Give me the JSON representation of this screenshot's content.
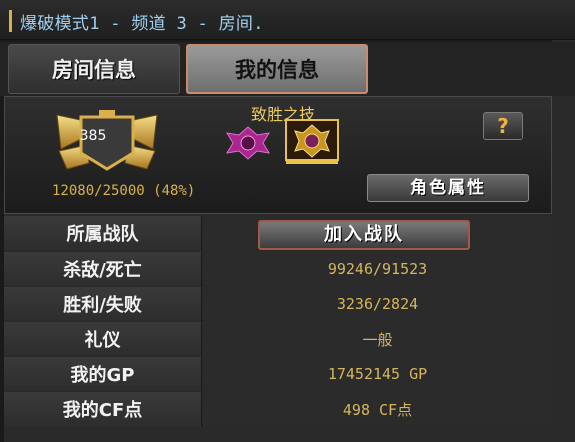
{
  "title_bar": {
    "text": "爆破模式1 - 频道 3 - 房间."
  },
  "tabs": [
    {
      "label": "房间信息",
      "active": false
    },
    {
      "label": "我的信息",
      "active": true
    }
  ],
  "profile": {
    "rank": "385",
    "exp": "12080/25000 (48%)",
    "skills_title": "致胜之技",
    "skills": [
      "pink-emblem-icon",
      "gold-emblem-icon"
    ],
    "help_label": "?",
    "attributes_button": "角色属性"
  },
  "stats": [
    {
      "label": "所属战队",
      "value": "",
      "button": "加入战队"
    },
    {
      "label": "杀敌/死亡",
      "value": "99246/91523"
    },
    {
      "label": "胜利/失败",
      "value": "3236/2824"
    },
    {
      "label": "礼仪",
      "value": "一般"
    },
    {
      "label": "我的GP",
      "value": "17452145 GP"
    },
    {
      "label": "我的CF点",
      "value": "498 CF点"
    }
  ],
  "colors": {
    "accent_gold": "#d8b14b",
    "title_blue": "#9fd0ef",
    "help_orange": "#f2b23c"
  }
}
